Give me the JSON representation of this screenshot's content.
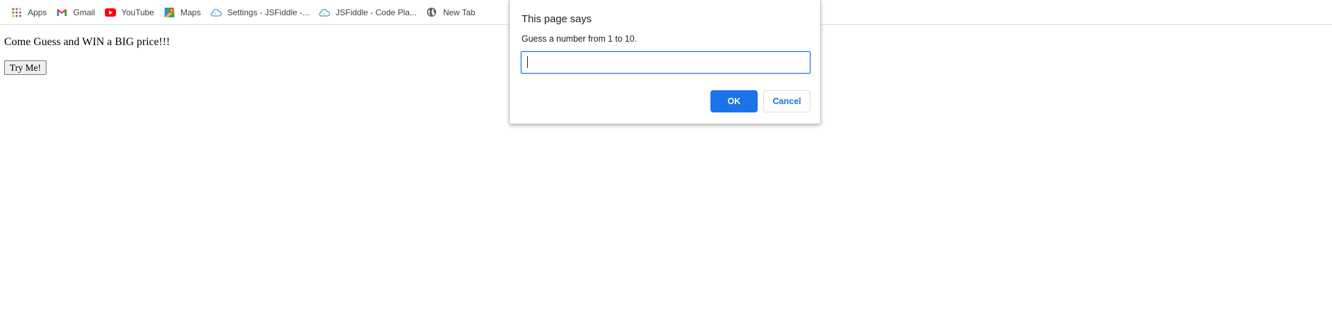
{
  "bookmarks": [
    {
      "label": "Apps",
      "icon": "apps-grid-icon"
    },
    {
      "label": "Gmail",
      "icon": "gmail-icon"
    },
    {
      "label": "YouTube",
      "icon": "youtube-icon"
    },
    {
      "label": "Maps",
      "icon": "maps-icon"
    },
    {
      "label": "Settings - JSFiddle -...",
      "icon": "jsfiddle-cloud-icon"
    },
    {
      "label": "JSFiddle - Code Pla...",
      "icon": "jsfiddle-cloud-icon"
    },
    {
      "label": "New Tab",
      "icon": "globe-icon"
    }
  ],
  "page": {
    "intro_text": "Come Guess and WIN a BIG price!!!",
    "try_button_label": "Try Me!"
  },
  "dialog": {
    "title": "This page says",
    "message": "Guess a number from 1 to 10.",
    "input_value": "",
    "ok_label": "OK",
    "cancel_label": "Cancel"
  },
  "colors": {
    "accent": "#1a73e8",
    "youtube_red": "#ff0000",
    "gmail_red": "#ea4335"
  }
}
